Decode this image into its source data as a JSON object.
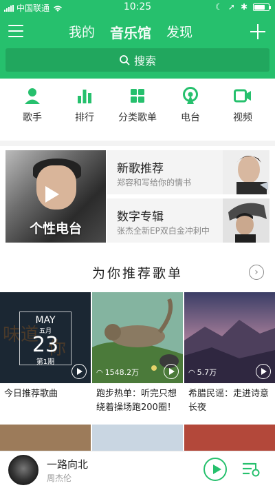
{
  "status_bar": {
    "carrier": "中国联通",
    "time": "10:25"
  },
  "nav": {
    "tabs": [
      "我的",
      "音乐馆",
      "发现"
    ],
    "active_tab": "音乐馆"
  },
  "search": {
    "placeholder": "搜索"
  },
  "quick_links": [
    {
      "label": "歌手",
      "icon": "singer-icon"
    },
    {
      "label": "排行",
      "icon": "chart-icon"
    },
    {
      "label": "分类歌单",
      "icon": "category-icon"
    },
    {
      "label": "电台",
      "icon": "radio-icon"
    },
    {
      "label": "视频",
      "icon": "video-icon"
    }
  ],
  "radio": {
    "title": "个性电台"
  },
  "promos": [
    {
      "title": "新歌推荐",
      "subtitle": "郑容和写给你的情书"
    },
    {
      "title": "数字专辑",
      "subtitle": "张杰全新EP双白金冲刺中"
    }
  ],
  "section": {
    "title": "为你推荐歌单"
  },
  "playlists": [
    {
      "caption": "今日推荐歌曲",
      "month": "MAY",
      "month_cn": "五月",
      "day": "23",
      "issue": "第1期",
      "plays": ""
    },
    {
      "caption": "跑步热单：听完只想绕着操场跑200圈！",
      "plays": "1548.2万"
    },
    {
      "caption": "希腊民谣：走进诗意长夜",
      "plays": "5.7万"
    }
  ],
  "player": {
    "song": "一路向北",
    "artist": "周杰伦"
  },
  "colors": {
    "accent": "#26c06d"
  }
}
